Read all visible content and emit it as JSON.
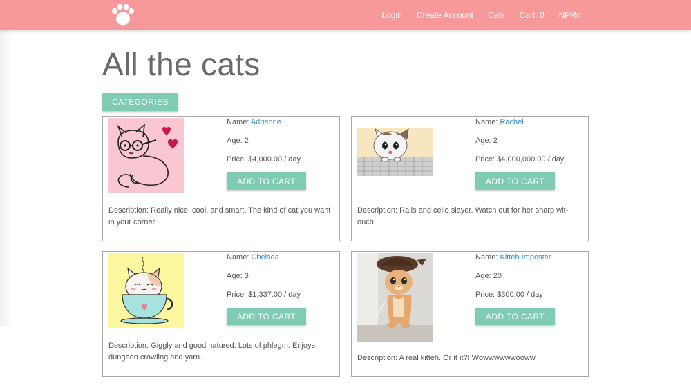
{
  "nav": {
    "links": [
      "Login",
      "Create Account",
      "Cats",
      "Cart: 0",
      "NPRrr"
    ]
  },
  "page": {
    "title": "All the cats",
    "categories_label": "CATEGORIES"
  },
  "labels": {
    "name": "Name: ",
    "age": "Age: ",
    "price": "Price: ",
    "description": "Description: ",
    "add_to_cart": "ADD TO CART"
  },
  "cats": [
    {
      "name": "Adrienne",
      "age": "2",
      "price": "$4,000.00 / day",
      "description": "Really nice, cool, and smart. The kind of cat you want in your corner.",
      "image": "cat-with-glasses-drawing"
    },
    {
      "name": "Rachel",
      "age": "2",
      "price": "$4,000,000.00 / day",
      "description": "Rails and cello slayer. Watch out for her sharp wit-ouch!",
      "image": "anime-kitten-on-keyboard"
    },
    {
      "name": "Chelsea",
      "age": "3",
      "price": "$1,337.00 / day",
      "description": "Giggly and good natured. Lots of phlegm. Enjoys dungeon crawling and yarn.",
      "image": "cat-in-teacup-drawing"
    },
    {
      "name": "Kitteh Imposter",
      "age": "20",
      "price": "$300.00 / day",
      "description": "A real kitteh. Or it it?! Wowwwwwwooww",
      "image": "kitten-in-hat-photo"
    }
  ],
  "colors": {
    "navbar": "#f7999a",
    "button": "#7fcbb3",
    "link": "#2e8fc6"
  }
}
